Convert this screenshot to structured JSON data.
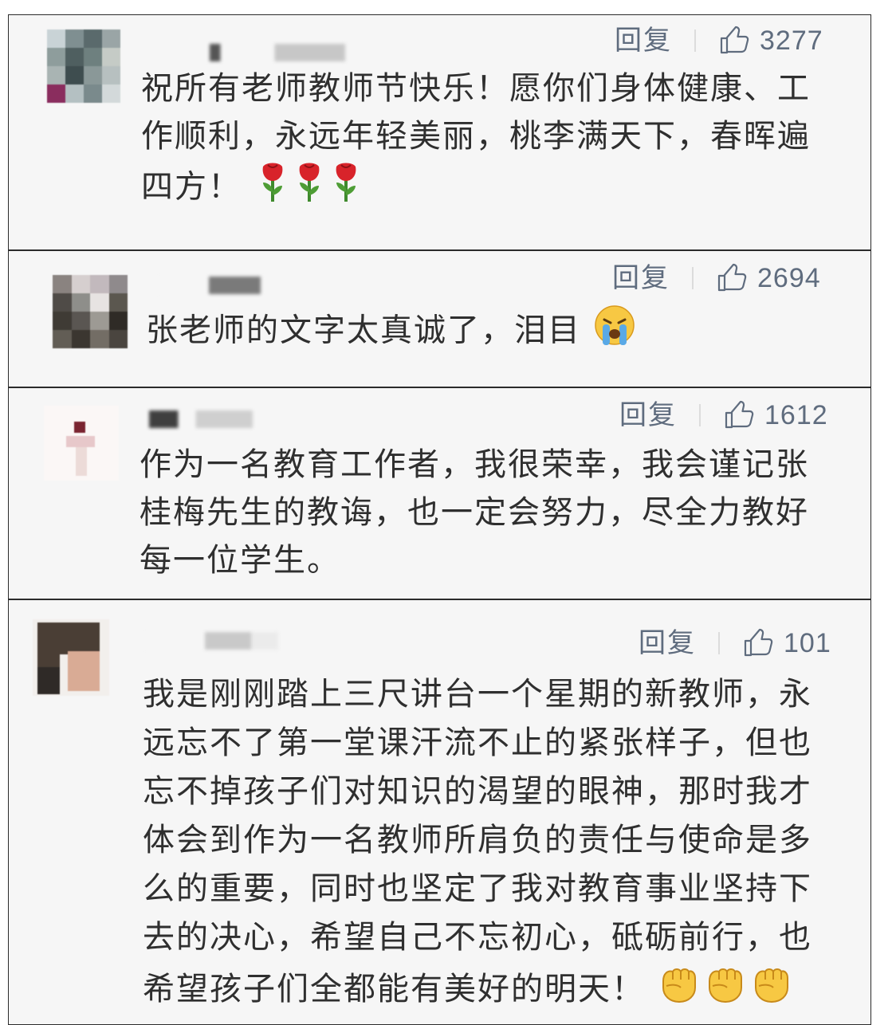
{
  "comments": [
    {
      "reply_label": "回复",
      "like_icon": "thumbs-up-icon",
      "likes": "3277",
      "text": "祝所有老师教师节快乐！愿你们身体健康、工作顺利，永远年轻美丽，桃李满天下，春晖遍四方！",
      "emojis": [
        "rose-icon",
        "rose-icon",
        "rose-icon"
      ]
    },
    {
      "reply_label": "回复",
      "like_icon": "thumbs-up-icon",
      "likes": "2694",
      "text": "张老师的文字太真诚了，泪目",
      "emojis": [
        "crying-face-icon"
      ]
    },
    {
      "reply_label": "回复",
      "like_icon": "thumbs-up-icon",
      "likes": "1612",
      "text": "作为一名教育工作者，我很荣幸，我会谨记张桂梅先生的教诲，也一定会努力，尽全力教好每一位学生。",
      "emojis": []
    },
    {
      "reply_label": "回复",
      "like_icon": "thumbs-up-icon",
      "likes": "101",
      "text": "我是刚刚踏上三尺讲台一个星期的新教师，永远忘不了第一堂课汗流不止的紧张样子，但也忘不掉孩子们对知识的渴望的眼神，那时我才体会到作为一名教师所肩负的责任与使命是多么的重要，同时也坚定了我对教育事业坚持下去的决心，希望自己不忘初心，砥砺前行，也希望孩子们全都能有美好的明天！",
      "emojis": [
        "fist-icon",
        "fist-icon",
        "fist-icon"
      ]
    }
  ],
  "colors": {
    "card_bg": "#f6f6f6",
    "action_gray": "#5f6c7e",
    "text": "#2f2f2f",
    "border": "#2b2b2b"
  }
}
